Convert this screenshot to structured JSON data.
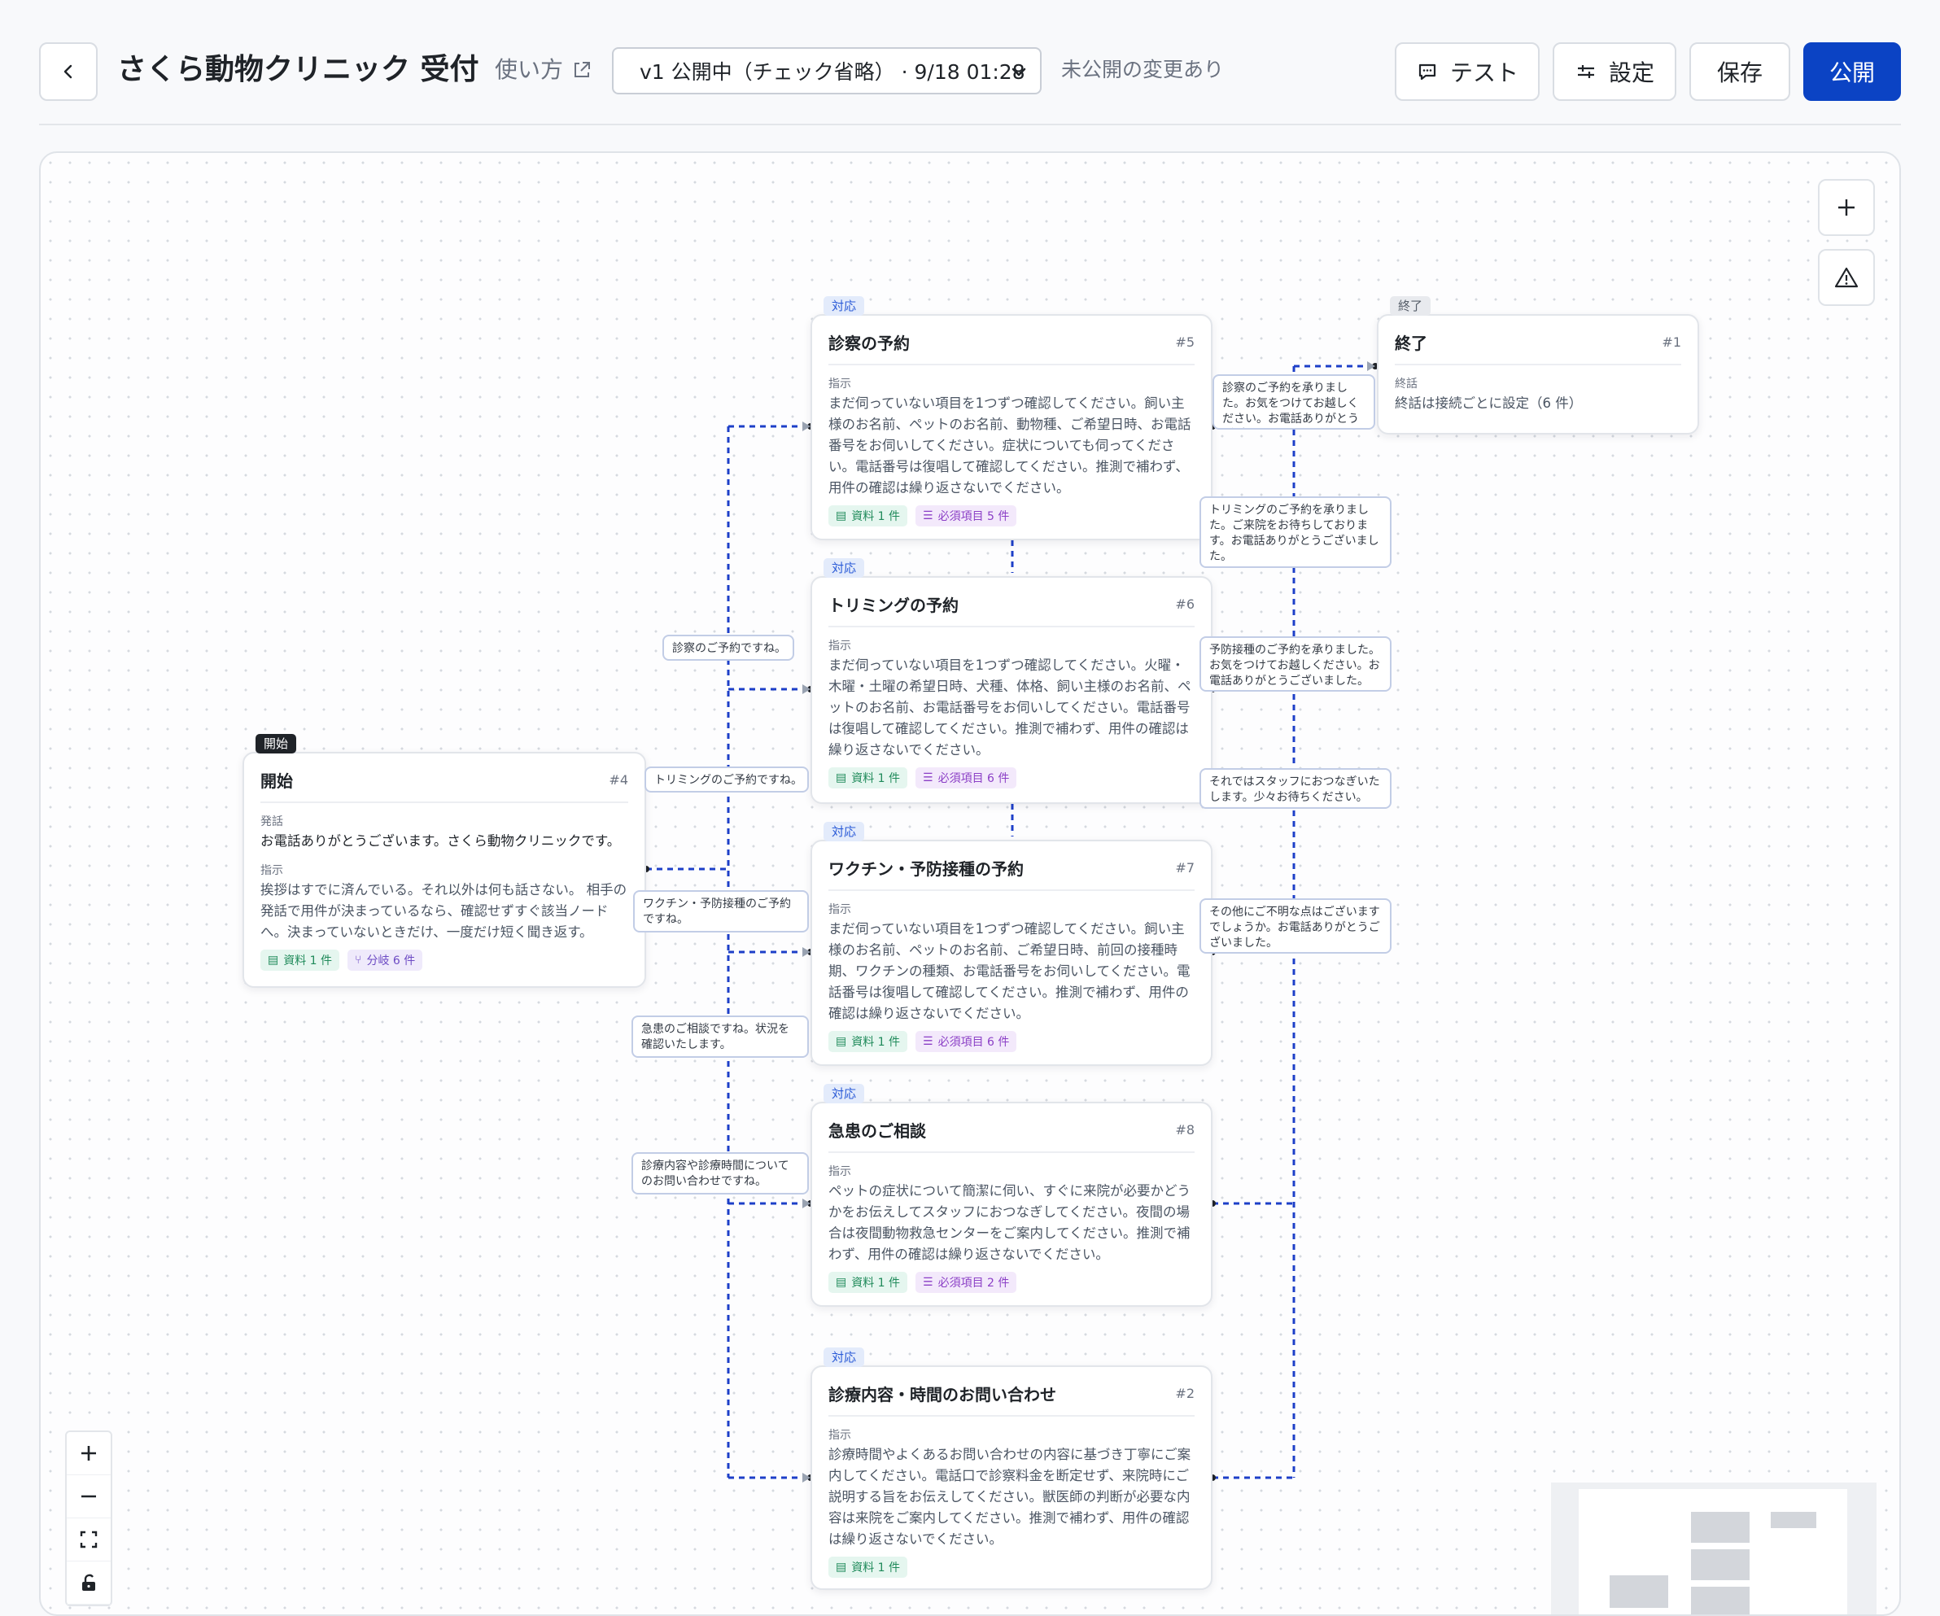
{
  "header": {
    "title": "さくら動物クリニック 受付",
    "howto_label": "使い方",
    "version_select": "v1 公開中（チェック省略） · 9/18 01:28",
    "unpublished_note": "未公開の変更あり",
    "test_label": "テスト",
    "settings_label": "設定",
    "save_label": "保存",
    "publish_label": "公開"
  },
  "colors": {
    "accent": "#0b43c4",
    "edge": "#1d3fc8"
  },
  "nodes": [
    {
      "tag": "開始",
      "title": "開始",
      "num": "#4",
      "speech_label": "発話",
      "speech": "お電話ありがとうございます。さくら動物クリニックです。",
      "instr_label": "指示",
      "instr": "挨拶はすでに済んでいる。それ以外は何も話さない。 相手の発話で用件が決まっているなら、確認せずすぐ該当ノードへ。決まっていないときだけ、一度だけ短く聞き返す。",
      "chips": [
        "資料 1 件",
        "分岐 6 件"
      ]
    },
    {
      "tag": "対応",
      "title": "診察の予約",
      "num": "#5",
      "instr_label": "指示",
      "instr": "まだ伺っていない項目を1つずつ確認してください。飼い主様のお名前、ペットのお名前、動物種、ご希望日時、お電話番号をお伺いしてください。症状についても伺ってください。電話番号は復唱して確認してください。推測で補わず、用件の確認は繰り返さないでください。",
      "chips": [
        "資料 1 件",
        "必須項目 5 件"
      ]
    },
    {
      "tag": "対応",
      "title": "トリミングの予約",
      "num": "#6",
      "instr_label": "指示",
      "instr": "まだ伺っていない項目を1つずつ確認してください。火曜・木曜・土曜の希望日時、犬種、体格、飼い主様のお名前、ペットのお名前、お電話番号をお伺いしてください。電話番号は復唱して確認してください。推測で補わず、用件の確認は繰り返さないでください。",
      "chips": [
        "資料 1 件",
        "必須項目 6 件"
      ]
    },
    {
      "tag": "対応",
      "title": "ワクチン・予防接種の予約",
      "num": "#7",
      "instr_label": "指示",
      "instr": "まだ伺っていない項目を1つずつ確認してください。飼い主様のお名前、ペットのお名前、ご希望日時、前回の接種時期、ワクチンの種類、お電話番号をお伺いしてください。電話番号は復唱して確認してください。推測で補わず、用件の確認は繰り返さないでください。",
      "chips": [
        "資料 1 件",
        "必須項目 6 件"
      ]
    },
    {
      "tag": "対応",
      "title": "急患のご相談",
      "num": "#8",
      "instr_label": "指示",
      "instr": "ペットの症状について簡潔に伺い、すぐに来院が必要かどうかをお伝えしてスタッフにおつなぎしてください。夜間の場合は夜間動物救急センターをご案内してください。推測で補わず、用件の確認は繰り返さないでください。",
      "chips": [
        "資料 1 件",
        "必須項目 2 件"
      ]
    },
    {
      "tag": "対応",
      "title": "診療内容・時間のお問い合わせ",
      "num": "#2",
      "instr_label": "指示",
      "instr": "診療時間やよくあるお問い合わせの内容に基づき丁寧にご案内してください。電話口で診察料金を断定せず、来院時にご説明する旨をお伝えしてください。獣医師の判断が必要な内容は来院をご案内してください。推測で補わず、用件の確認は繰り返さないでください。",
      "chips": [
        "資料 1 件"
      ]
    },
    {
      "tag": "終了",
      "title": "終了",
      "num": "#1",
      "end_label": "終話",
      "end_text": "終話は接続ごとに設定（6 件）"
    }
  ],
  "edge_labels": {
    "left": [
      "診察のご予約ですね。",
      "トリミングのご予約ですね。",
      "ワクチン・予防接種のご予約ですね。",
      "急患のご相談ですね。状況を確認いたします。",
      "診療内容や診療時間についてのお問い合わせですね。"
    ],
    "right": [
      "診察のご予約を承りました。お気をつけてお越しください。お電話ありがとうございました。",
      "トリミングのご予約を承りました。ご来院をお待ちしております。お電話ありがとうございました。",
      "予防接種のご予約を承りました。お気をつけてお越しください。お電話ありがとうございました。",
      "それではスタッフにおつなぎいたします。少々お待ちください。",
      "その他にご不明な点はございますでしょうか。お電話ありがとうございました。"
    ]
  }
}
